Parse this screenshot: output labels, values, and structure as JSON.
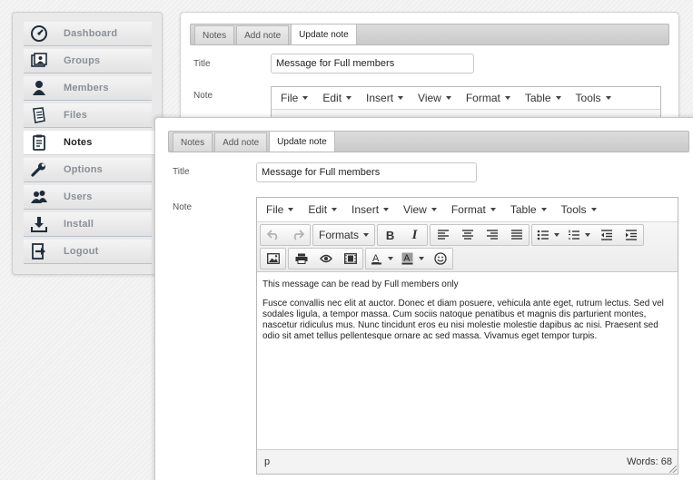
{
  "sidebar": {
    "items": [
      {
        "label": "Dashboard",
        "icon": "dashboard-gauge-icon",
        "active": false
      },
      {
        "label": "Groups",
        "icon": "groups-icon",
        "active": false
      },
      {
        "label": "Members",
        "icon": "member-icon",
        "active": false
      },
      {
        "label": "Files",
        "icon": "files-icon",
        "active": false
      },
      {
        "label": "Notes",
        "icon": "notes-clipboard-icon",
        "active": true
      },
      {
        "label": "Options",
        "icon": "wrench-icon",
        "active": false
      },
      {
        "label": "Users",
        "icon": "users-icon",
        "active": false
      },
      {
        "label": "Install",
        "icon": "download-icon",
        "active": false
      },
      {
        "label": "Logout",
        "icon": "logout-icon",
        "active": false
      }
    ]
  },
  "back_panel": {
    "tabs": [
      "Notes",
      "Add note",
      "Update note"
    ],
    "active_tab": "Update note",
    "title_label": "Title",
    "title_value": "Message for Full members",
    "note_label": "Note",
    "menu": [
      "File",
      "Edit",
      "Insert",
      "View",
      "Format",
      "Table",
      "Tools"
    ]
  },
  "front_panel": {
    "tabs": [
      "Notes",
      "Add note",
      "Update note"
    ],
    "active_tab": "Update note",
    "title_label": "Title",
    "title_value": "Message for Full members",
    "note_label": "Note",
    "editor": {
      "menu": [
        "File",
        "Edit",
        "Insert",
        "View",
        "Format",
        "Table",
        "Tools"
      ],
      "formats_label": "Formats",
      "content": {
        "line1": "This message can be read by Full members only",
        "para2": "Fusce convallis nec elit at auctor. Donec et diam posuere, vehicula ante eget, rutrum lectus. Sed vel sodales ligula, a tempor massa. Cum sociis natoque penatibus et magnis dis parturient montes, nascetur ridiculus mus. Nunc tincidunt eros eu nisi molestie molestie dapibus ac nisi. Praesent sed odio sit amet tellus pellentesque ornare ac sed massa. Vivamus eget tempor turpis."
      },
      "status_path": "p",
      "word_count": "Words: 68"
    }
  },
  "colors": {
    "accent_dark": "#1f2d3a",
    "inactive_label": "#8a8f96"
  }
}
